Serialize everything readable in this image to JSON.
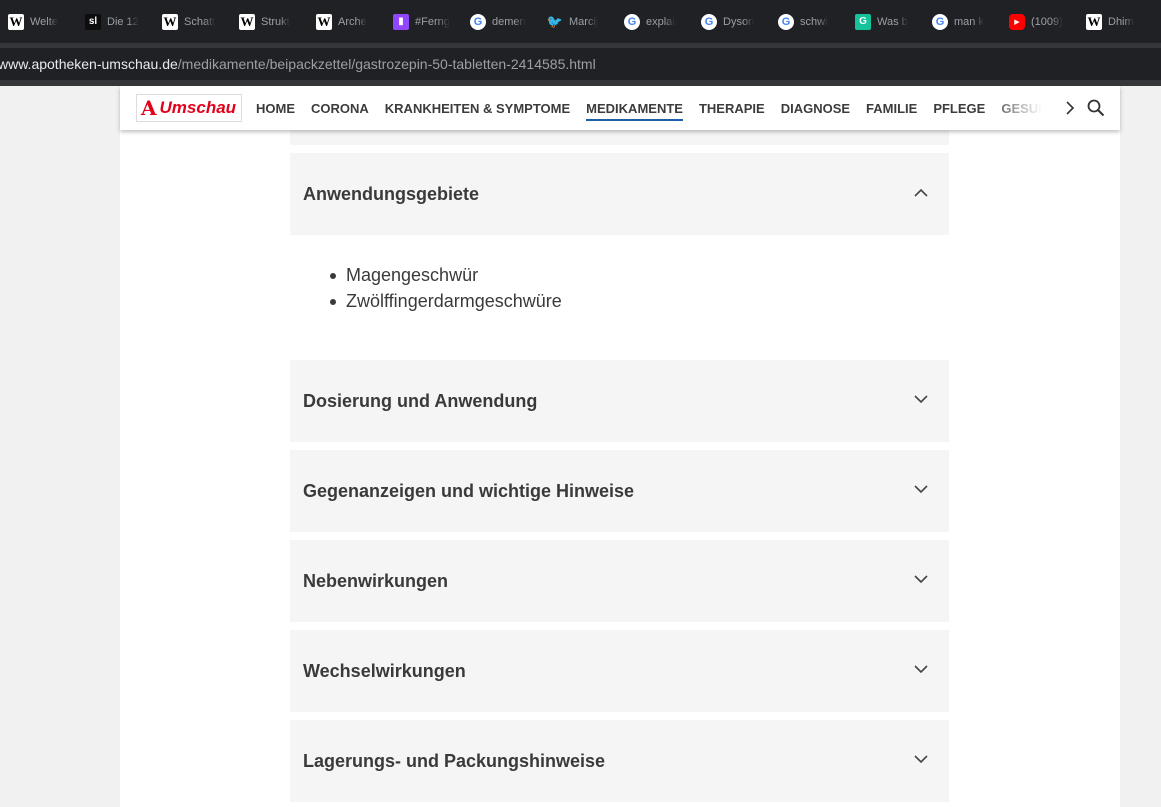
{
  "browser": {
    "bookmarks": [
      {
        "icon": "wikipedia-icon",
        "glyph": "W",
        "cls": "w",
        "label": "Welte"
      },
      {
        "icon": "sl-icon",
        "glyph": "sl",
        "cls": "sl",
        "label": "Die 12"
      },
      {
        "icon": "wikipedia-icon",
        "glyph": "W",
        "cls": "w",
        "label": "Schatt"
      },
      {
        "icon": "wikipedia-icon",
        "glyph": "W",
        "cls": "w",
        "label": "Strukt"
      },
      {
        "icon": "wikipedia-icon",
        "glyph": "W",
        "cls": "w",
        "label": "Arche"
      },
      {
        "icon": "twitch-icon",
        "glyph": "▮",
        "cls": "tw",
        "label": "#Ferng"
      },
      {
        "icon": "google-icon",
        "glyph": "G",
        "cls": "g",
        "label": "demen"
      },
      {
        "icon": "twitter-icon",
        "glyph": "🐦",
        "cls": "bird",
        "label": "Marcij"
      },
      {
        "icon": "google-icon",
        "glyph": "G",
        "cls": "g",
        "label": "explai"
      },
      {
        "icon": "google-icon",
        "glyph": "G",
        "cls": "g",
        "label": "Dyson"
      },
      {
        "icon": "google-icon",
        "glyph": "G",
        "cls": "g",
        "label": "schwi"
      },
      {
        "icon": "grammarly-icon",
        "glyph": "G",
        "cls": "gram",
        "label": "Was b"
      },
      {
        "icon": "google-icon",
        "glyph": "G",
        "cls": "g",
        "label": "man k"
      },
      {
        "icon": "youtube-icon",
        "glyph": "▶",
        "cls": "yt",
        "label": "(1009)"
      },
      {
        "icon": "wikipedia-icon",
        "glyph": "W",
        "cls": "w",
        "label": "Dhim"
      },
      {
        "icon": "extension-icon",
        "glyph": "+",
        "cls": "ext",
        "label": ""
      }
    ],
    "url": {
      "host": "www.apotheken-umschau.de",
      "path": "/medikamente/beipackzettel/gastrozepin-50-tabletten-2414585.html"
    }
  },
  "site": {
    "logo_mark": "A",
    "logo_text": "Umschau",
    "nav": [
      "HOME",
      "CORONA",
      "KRANKHEITEN & SYMPTOME",
      "MEDIKAMENTE",
      "THERAPIE",
      "DIAGNOSE",
      "FAMILIE",
      "PFLEGE",
      "GESUNDHEIT"
    ],
    "active_nav": "MEDIKAMENTE"
  },
  "accordion": {
    "open": {
      "title": "Anwendungsgebiete",
      "items": [
        "Magengeschwür",
        "Zwölffingerdarmgeschwüre"
      ]
    },
    "collapsed": [
      "Dosierung und Anwendung",
      "Gegenanzeigen und wichtige Hinweise",
      "Nebenwirkungen",
      "Wechselwirkungen",
      "Lagerungs- und Packungshinweise"
    ]
  },
  "colors": {
    "brand_red": "#e2001a",
    "active_underline": "#1a5fa8",
    "panel_bg": "#f5f5f5",
    "text": "#3a3a3a"
  }
}
